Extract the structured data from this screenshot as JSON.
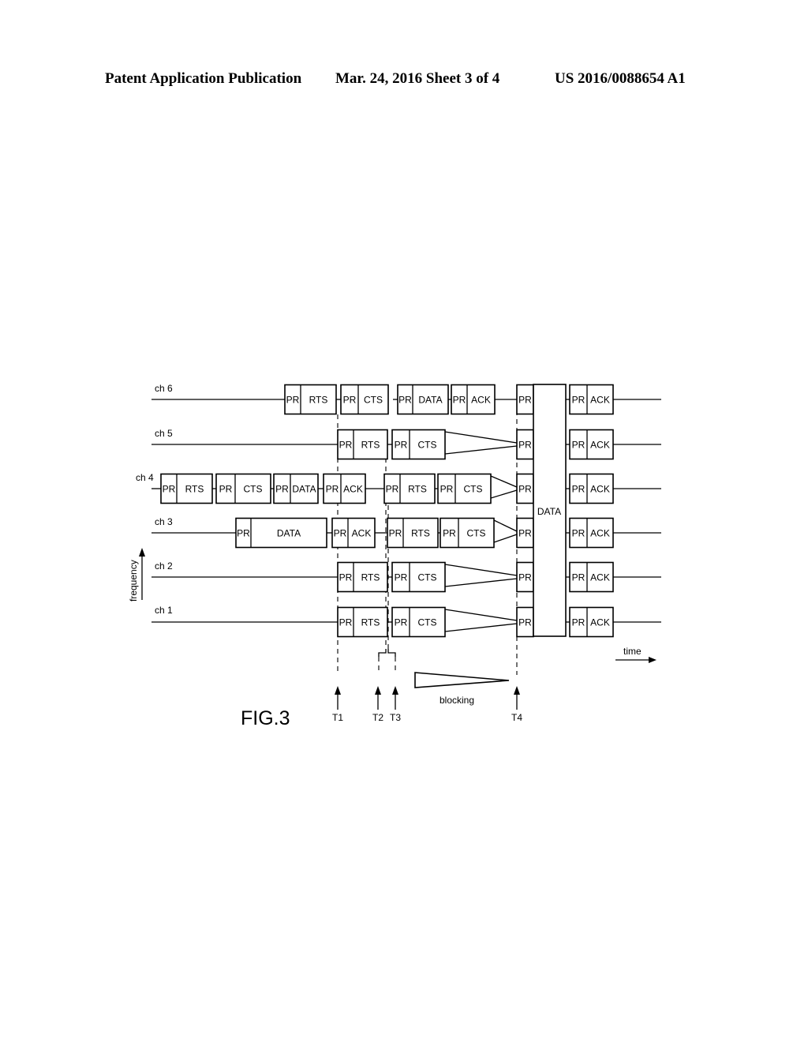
{
  "header": {
    "publication": "Patent Application Publication",
    "date_sheet": "Mar. 24, 2016  Sheet 3 of 4",
    "number": "US 2016/0088654 A1"
  },
  "figure": {
    "caption": "FIG.3",
    "axes": {
      "frequency_label": "frequency",
      "time_label": "time"
    },
    "channels": [
      {
        "name": "ch 6",
        "frames": [
          {
            "pr": "PR",
            "label": "RTS"
          },
          {
            "pr": "PR",
            "label": "CTS"
          },
          {
            "pr": "PR",
            "label": "DATA"
          },
          {
            "pr": "PR",
            "label": "ACK"
          },
          {
            "pr": "PR",
            "label": ""
          },
          {
            "pr": "PR",
            "label": "ACK"
          }
        ]
      },
      {
        "name": "ch 5",
        "frames": [
          {
            "pr": "PR",
            "label": "RTS"
          },
          {
            "pr": "PR",
            "label": "CTS"
          },
          {
            "pr": "PR",
            "label": ""
          },
          {
            "pr": "PR",
            "label": "ACK"
          }
        ]
      },
      {
        "name": "ch 4",
        "frames": [
          {
            "pr": "PR",
            "label": "RTS"
          },
          {
            "pr": "PR",
            "label": "CTS"
          },
          {
            "pr": "PR",
            "label": "DATA"
          },
          {
            "pr": "PR",
            "label": "ACK"
          },
          {
            "pr": "PR",
            "label": "RTS"
          },
          {
            "pr": "PR",
            "label": "CTS"
          },
          {
            "pr": "PR",
            "label": ""
          },
          {
            "pr": "PR",
            "label": "ACK"
          }
        ]
      },
      {
        "name": "ch 3",
        "frames": [
          {
            "pr": "PR",
            "label": "DATA"
          },
          {
            "pr": "PR",
            "label": "ACK"
          },
          {
            "pr": "PR",
            "label": "RTS"
          },
          {
            "pr": "PR",
            "label": "CTS"
          },
          {
            "pr": "PR",
            "label": ""
          },
          {
            "pr": "PR",
            "label": "ACK"
          }
        ]
      },
      {
        "name": "ch 2",
        "frames": [
          {
            "pr": "PR",
            "label": "RTS"
          },
          {
            "pr": "PR",
            "label": "CTS"
          },
          {
            "pr": "PR",
            "label": ""
          },
          {
            "pr": "PR",
            "label": "ACK"
          }
        ]
      },
      {
        "name": "ch 1",
        "frames": [
          {
            "pr": "PR",
            "label": "RTS"
          },
          {
            "pr": "PR",
            "label": "CTS"
          },
          {
            "pr": "PR",
            "label": ""
          },
          {
            "pr": "PR",
            "label": "ACK"
          }
        ]
      }
    ],
    "aggregated_data_label": "DATA",
    "blocking_label": "blocking",
    "time_markers": [
      "T1",
      "T2",
      "T3",
      "T4"
    ]
  }
}
